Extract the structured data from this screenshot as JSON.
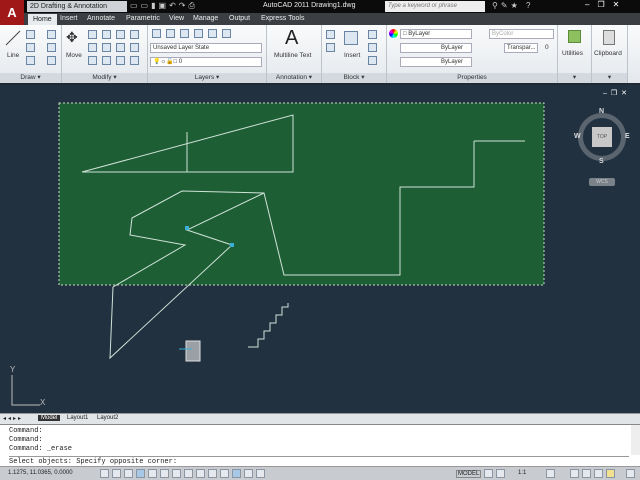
{
  "titlebar": {
    "workspace": "2D Drafting & Annotation",
    "app_title": "AutoCAD 2011   Drawing1.dwg",
    "search_placeholder": "Type a keyword or phrase",
    "app_button": "A"
  },
  "tabs": [
    "Home",
    "Insert",
    "Annotate",
    "Parametric",
    "View",
    "Manage",
    "Output",
    "Express Tools"
  ],
  "ribbon": {
    "draw": {
      "label": "Draw ▾",
      "line": "Line"
    },
    "modify": {
      "label": "Modify ▾",
      "move": "Move"
    },
    "layers": {
      "label": "Layers ▾",
      "layer_state": "Unsaved Layer State",
      "current_layer": "0"
    },
    "annotation": {
      "label": "Annotation ▾",
      "multiline_text": "Multiline Text",
      "glyph": "A"
    },
    "block": {
      "label": "Block ▾",
      "insert": "Insert"
    },
    "properties": {
      "label": "Properties",
      "color": "ByLayer",
      "plot_color": "ByColor",
      "lineweight": "ByLayer",
      "linetype": "ByLayer",
      "transparency_label": "Transpar...",
      "transparency_value": "0"
    },
    "utilities": {
      "label": "Utilities"
    },
    "clipboard": {
      "label": "Clipboard"
    }
  },
  "viewcube": {
    "top": "TOP",
    "n": "N",
    "s": "S",
    "e": "E",
    "w": "W",
    "ucs": "WCS"
  },
  "ucs_axes": {
    "x": "X",
    "y": "Y"
  },
  "layout_tabs": [
    "Model",
    "Layout1",
    "Layout2"
  ],
  "command_history": [
    "Command:",
    "Command:",
    "Command: _erase",
    "Select objects: Specify opposite corner:"
  ],
  "status": {
    "coordinates": "1.1275, 11.0365, 0.0000",
    "model": "MODEL",
    "annotation_scale": "1:1"
  },
  "colors": {
    "canvas": "#223140",
    "selection_fill": "#1e5e34",
    "line": "#cfe3d8"
  }
}
